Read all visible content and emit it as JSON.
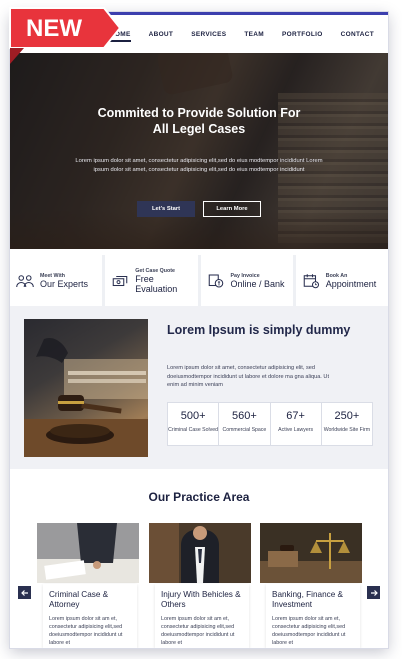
{
  "badge": {
    "label": "NEW"
  },
  "nav": {
    "items": [
      "HOME",
      "ABOUT",
      "SERVICES",
      "TEAM",
      "PORTFOLIO",
      "CONTACT"
    ],
    "active": "HOME"
  },
  "hero": {
    "title_line1": "Commited to Provide Solution For",
    "title_line2": "All Legel Cases",
    "text": "Lorem ipsum dolor sit amet, consectetur adipisicing elit,sed do eius modtempor incididunt Lorem ipsum dolor sit amet, consectetur adipisicing elit,sed do eius modtempor incididunt",
    "btn_start": "Let's Start",
    "btn_more": "Learn More"
  },
  "features": [
    {
      "small": "Meet With",
      "big": "Our Experts",
      "icon": "people-icon"
    },
    {
      "small": "Get Case Quote",
      "big": "Free Evaluation",
      "icon": "money-icon"
    },
    {
      "small": "Pay Invoice",
      "big": "Online / Bank",
      "icon": "invoice-icon"
    },
    {
      "small": "Book An",
      "big": "Appointment",
      "icon": "calendar-icon"
    }
  ],
  "about": {
    "title": "Lorem Ipsum is simply dummy",
    "text": "Lorem ipsum dolor sit amet, consectetur adipisicing elit, sed doeiusmodtempor incididunt ut labore et dolore ma gna aliqua. Ut enim ad minim veniam",
    "stats": [
      {
        "num": "500+",
        "label": "Criminal Case Solved"
      },
      {
        "num": "560+",
        "label": "Commercial Space"
      },
      {
        "num": "67+",
        "label": "Active Lawyers"
      },
      {
        "num": "250+",
        "label": "Worldwide Site Firm"
      }
    ]
  },
  "practice": {
    "title": "Our Practice Area",
    "cards": [
      {
        "title": "Criminal Case & Attorney",
        "text": "Lorem ipsum dolor sit am et, consectetur adipisicing elit,sed doeiusmodtempor incididunt ut labore et"
      },
      {
        "title": "Injury With Behicles & Others",
        "text": "Lorem ipsum dolor sit am et, consectetur adipisicing elit,sed doeiusmodtempor incididunt ut labore et"
      },
      {
        "title": "Banking, Finance & Investment",
        "text": "Lorem ipsum dolor sit am et, consectetur adipisicing elit,sed doeiusmodtempor incididunt ut labore et"
      }
    ]
  },
  "colors": {
    "accent": "#3c3fae",
    "dark": "#1c2140",
    "ribbon": "#e8343c"
  }
}
